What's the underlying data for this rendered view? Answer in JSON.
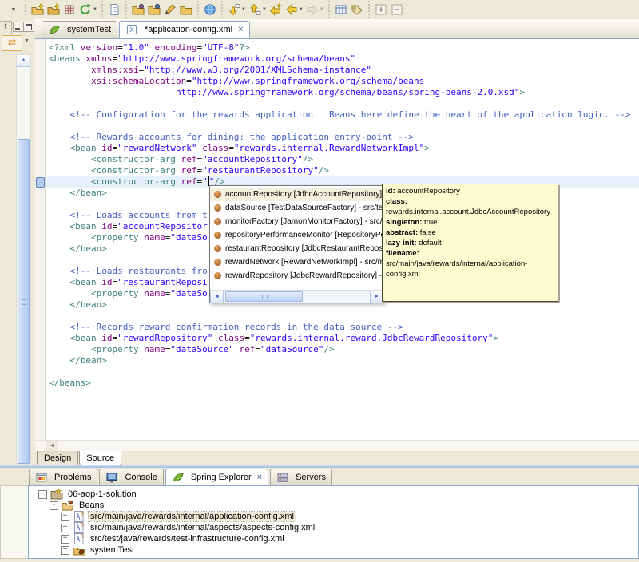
{
  "colors": {
    "chrome_bg": "#ece9d8",
    "editor_bg": "#ffffff",
    "current_line": "#e7f1fc",
    "tag": "#3f7f7f",
    "attribute": "#7f007f",
    "value": "#2a00ff",
    "comment": "#3f5fbf",
    "tooltip_bg": "#fbfcd0",
    "selection": "#f4efdc",
    "accent_blue": "#8ba6c6"
  },
  "glyphs": {
    "caret_down": "▼",
    "arrow_up": "▲",
    "arrow_left": "◄",
    "arrow_right": "►",
    "close": "×",
    "sync": "⇄"
  },
  "toolbar": {
    "groups": [
      {
        "items": [
          {
            "name": "toolbar-overflow-caret",
            "icon": "caret"
          }
        ]
      },
      {
        "items": [
          {
            "name": "new-wizard-button",
            "icon": "wiz1"
          },
          {
            "name": "import-wizard-button",
            "icon": "wiz2"
          },
          {
            "name": "new-table-button",
            "icon": "grid"
          },
          {
            "name": "refresh-button",
            "icon": "refresh",
            "caret": true
          }
        ]
      },
      {
        "items": [
          {
            "name": "report-button",
            "icon": "report"
          }
        ]
      },
      {
        "items": [
          {
            "name": "open-type-button",
            "icon": "folder-purple"
          },
          {
            "name": "open-resource-button",
            "icon": "folder-blue"
          },
          {
            "name": "search-button",
            "icon": "pencil"
          },
          {
            "name": "open-task-button",
            "icon": "folder-plain"
          }
        ]
      },
      {
        "items": [
          {
            "name": "web-browser-button",
            "icon": "globe"
          }
        ]
      },
      {
        "items": [
          {
            "name": "next-annotation-button",
            "icon": "down-arrow",
            "caret": true
          },
          {
            "name": "previous-annotation-button",
            "icon": "up-arrow",
            "caret": true
          },
          {
            "name": "last-edit-location-button",
            "icon": "star-arrow"
          },
          {
            "name": "back-button",
            "icon": "back-arrow",
            "caret": true
          },
          {
            "name": "forward-button",
            "icon": "forward-arrow",
            "caret": true,
            "disabled": true
          }
        ]
      },
      {
        "items": [
          {
            "name": "pin-editor-button",
            "icon": "table"
          },
          {
            "name": "mark-occurrences-button",
            "icon": "tag"
          }
        ]
      },
      {
        "items": [
          {
            "name": "expand-all-button",
            "icon": "plus-box"
          },
          {
            "name": "collapse-all-button",
            "icon": "minus-box"
          }
        ]
      }
    ]
  },
  "left_strip": {
    "tab_stub": "t"
  },
  "editor": {
    "tabs": [
      {
        "label": "systemTest",
        "icon": "spring-leaf",
        "active": false,
        "closable": false
      },
      {
        "label": "*application-config.xml",
        "icon": "xml-file",
        "active": true,
        "closable": true
      }
    ],
    "view_tabs": [
      {
        "label": "Design",
        "active": false
      },
      {
        "label": "Source",
        "active": true
      }
    ],
    "lines": [
      {
        "segs": [
          [
            "tag",
            "<?xml "
          ],
          [
            "att",
            "version"
          ],
          [
            "pln",
            "="
          ],
          [
            "val",
            "\"1.0\""
          ],
          [
            "pln",
            " "
          ],
          [
            "att",
            "encoding"
          ],
          [
            "pln",
            "="
          ],
          [
            "val",
            "\"UTF-8\""
          ],
          [
            "tag",
            "?>"
          ]
        ]
      },
      {
        "segs": [
          [
            "tag",
            "<beans "
          ],
          [
            "att",
            "xmlns"
          ],
          [
            "pln",
            "="
          ],
          [
            "val",
            "\"http://www.springframework.org/schema/beans\""
          ]
        ]
      },
      {
        "segs": [
          [
            "pln",
            "        "
          ],
          [
            "att",
            "xmlns:xsi"
          ],
          [
            "pln",
            "="
          ],
          [
            "val",
            "\"http://www.w3.org/2001/XMLSchema-instance\""
          ]
        ]
      },
      {
        "segs": [
          [
            "pln",
            "        "
          ],
          [
            "att",
            "xsi:schemaLocation"
          ],
          [
            "pln",
            "="
          ],
          [
            "val",
            "\"http://www.springframework.org/schema/beans"
          ]
        ]
      },
      {
        "segs": [
          [
            "pln",
            "                        "
          ],
          [
            "val",
            "http://www.springframework.org/schema/beans/spring-beans-2.0.xsd\""
          ],
          [
            "tag",
            ">"
          ]
        ]
      },
      {
        "segs": []
      },
      {
        "segs": [
          [
            "pln",
            "    "
          ],
          [
            "com",
            "<!-- Configuration for the rewards application.  Beans here define the heart of the application logic. -->"
          ]
        ]
      },
      {
        "segs": []
      },
      {
        "segs": [
          [
            "pln",
            "    "
          ],
          [
            "com",
            "<!-- Rewards accounts for dining: the application entry-point -->"
          ]
        ]
      },
      {
        "segs": [
          [
            "pln",
            "    "
          ],
          [
            "tag",
            "<bean "
          ],
          [
            "att",
            "id"
          ],
          [
            "pln",
            "="
          ],
          [
            "val",
            "\"rewardNetwork\""
          ],
          [
            "pln",
            " "
          ],
          [
            "att",
            "class"
          ],
          [
            "pln",
            "="
          ],
          [
            "val",
            "\"rewards.internal.RewardNetworkImpl\""
          ],
          [
            "tag",
            ">"
          ]
        ]
      },
      {
        "segs": [
          [
            "pln",
            "        "
          ],
          [
            "tag",
            "<constructor-arg "
          ],
          [
            "att",
            "ref"
          ],
          [
            "pln",
            "="
          ],
          [
            "val",
            "\"accountRepository\""
          ],
          [
            "tag",
            "/>"
          ]
        ]
      },
      {
        "segs": [
          [
            "pln",
            "        "
          ],
          [
            "tag",
            "<constructor-arg "
          ],
          [
            "att",
            "ref"
          ],
          [
            "pln",
            "="
          ],
          [
            "val",
            "\"restaurantRepository\""
          ],
          [
            "tag",
            "/>"
          ]
        ]
      },
      {
        "current": true,
        "segs": [
          [
            "pln",
            "        "
          ],
          [
            "tag",
            "<constructor-arg "
          ],
          [
            "att",
            "ref"
          ],
          [
            "pln",
            "="
          ],
          [
            "val",
            "\""
          ],
          [
            "caret",
            ""
          ],
          [
            "val",
            "\""
          ],
          [
            "tag",
            "/>"
          ]
        ]
      },
      {
        "segs": [
          [
            "pln",
            "    "
          ],
          [
            "tag",
            "</bean>"
          ]
        ]
      },
      {
        "segs": []
      },
      {
        "segs": [
          [
            "pln",
            "    "
          ],
          [
            "com",
            "<!-- Loads accounts from t"
          ]
        ]
      },
      {
        "segs": [
          [
            "pln",
            "    "
          ],
          [
            "tag",
            "<bean "
          ],
          [
            "att",
            "id"
          ],
          [
            "pln",
            "="
          ],
          [
            "val",
            "\"accountRepositor"
          ]
        ]
      },
      {
        "segs": [
          [
            "pln",
            "        "
          ],
          [
            "tag",
            "<property "
          ],
          [
            "att",
            "name"
          ],
          [
            "pln",
            "="
          ],
          [
            "val",
            "\"dataSo"
          ]
        ]
      },
      {
        "segs": [
          [
            "pln",
            "    "
          ],
          [
            "tag",
            "</bean>"
          ]
        ]
      },
      {
        "segs": []
      },
      {
        "segs": [
          [
            "pln",
            "    "
          ],
          [
            "com",
            "<!-- Loads restaurants fro"
          ]
        ]
      },
      {
        "segs": [
          [
            "pln",
            "    "
          ],
          [
            "tag",
            "<bean "
          ],
          [
            "att",
            "id"
          ],
          [
            "pln",
            "="
          ],
          [
            "val",
            "\"restaurantReposi"
          ]
        ]
      },
      {
        "segs": [
          [
            "pln",
            "        "
          ],
          [
            "tag",
            "<property "
          ],
          [
            "att",
            "name"
          ],
          [
            "pln",
            "="
          ],
          [
            "val",
            "\"dataSo"
          ]
        ]
      },
      {
        "segs": [
          [
            "pln",
            "    "
          ],
          [
            "tag",
            "</bean>"
          ]
        ]
      },
      {
        "segs": []
      },
      {
        "segs": [
          [
            "pln",
            "    "
          ],
          [
            "com",
            "<!-- Records reward confirmation records in the data source -->"
          ]
        ]
      },
      {
        "segs": [
          [
            "pln",
            "    "
          ],
          [
            "tag",
            "<bean "
          ],
          [
            "att",
            "id"
          ],
          [
            "pln",
            "="
          ],
          [
            "val",
            "\"rewardRepository\""
          ],
          [
            "pln",
            " "
          ],
          [
            "att",
            "class"
          ],
          [
            "pln",
            "="
          ],
          [
            "val",
            "\"rewards.internal.reward.JdbcRewardRepository\""
          ],
          [
            "tag",
            ">"
          ]
        ]
      },
      {
        "segs": [
          [
            "pln",
            "        "
          ],
          [
            "tag",
            "<property "
          ],
          [
            "att",
            "name"
          ],
          [
            "pln",
            "="
          ],
          [
            "val",
            "\"dataSource\""
          ],
          [
            "pln",
            " "
          ],
          [
            "att",
            "ref"
          ],
          [
            "pln",
            "="
          ],
          [
            "val",
            "\"dataSource\""
          ],
          [
            "tag",
            "/>"
          ]
        ]
      },
      {
        "segs": [
          [
            "pln",
            "    "
          ],
          [
            "tag",
            "</bean>"
          ]
        ]
      },
      {
        "segs": []
      },
      {
        "segs": [
          [
            "tag",
            "</beans>"
          ]
        ]
      }
    ]
  },
  "popup": {
    "items": [
      {
        "label": "accountRepository [JdbcAccountRepository] - src/main/ja",
        "selected": true
      },
      {
        "label": "dataSource [TestDataSourceFactory] - src/test/ja",
        "selected": false
      },
      {
        "label": "monitorFactory [JamonMonitorFactory] - src/main",
        "selected": false
      },
      {
        "label": "repositoryPerformanceMonitor [RepositoryPerform",
        "selected": false
      },
      {
        "label": "restaurantRepository [JdbcRestaurantRepository",
        "selected": false
      },
      {
        "label": "rewardNetwork [RewardNetworkImpl] - src/main/j",
        "selected": false
      },
      {
        "label": "rewardRepository [JdbcRewardRepository] - src/r",
        "selected": false
      }
    ]
  },
  "tooltip": {
    "lines": [
      {
        "b": "id:",
        "t": " accountRepository"
      },
      {
        "b": "class:",
        "t": ""
      },
      {
        "b": "",
        "t": " rewards.internal.account.JdbcAccountRepository",
        "nowrap": true
      },
      {
        "b": "singleton:",
        "t": " true"
      },
      {
        "b": "abstract:",
        "t": " false"
      },
      {
        "b": "lazy-init:",
        "t": " default"
      },
      {
        "b": "filename:",
        "t": " src/main/java/rewards/internal/application-config.xml"
      }
    ]
  },
  "bottom_panel": {
    "tabs": [
      {
        "label": "Problems",
        "icon": "problems",
        "active": false,
        "closable": false
      },
      {
        "label": "Console",
        "icon": "console",
        "active": false,
        "closable": false
      },
      {
        "label": "Spring Explorer",
        "icon": "spring-leaf",
        "active": true,
        "closable": true
      },
      {
        "label": "Servers",
        "icon": "servers",
        "active": false,
        "closable": false
      }
    ],
    "tree": [
      {
        "depth": 0,
        "expander": "-",
        "icon": "project",
        "label": "06-aop-1-solution",
        "selected": false
      },
      {
        "depth": 1,
        "expander": "-",
        "icon": "beans-folder",
        "label": "Beans",
        "selected": false
      },
      {
        "depth": 2,
        "expander": "+",
        "icon": "spring-config",
        "label": "src/main/java/rewards/internal/application-config.xml",
        "selected": true
      },
      {
        "depth": 2,
        "expander": "+",
        "icon": "spring-config",
        "label": "src/main/java/rewards/internal/aspects/aspects-config.xml",
        "selected": false
      },
      {
        "depth": 2,
        "expander": "+",
        "icon": "spring-config",
        "label": "src/test/java/rewards/test-infrastructure-config.xml",
        "selected": false
      },
      {
        "depth": 2,
        "expander": "+",
        "icon": "bean-folder",
        "label": "systemTest",
        "selected": false
      }
    ]
  }
}
